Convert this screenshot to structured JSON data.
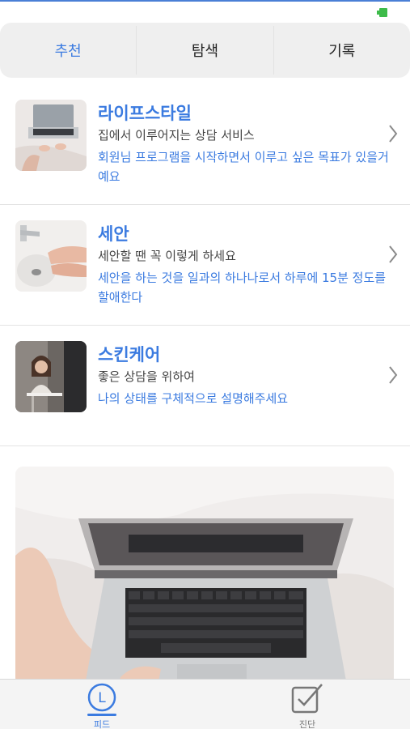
{
  "status": {
    "battery_color": "#3dbb4a"
  },
  "segment": {
    "tabs": [
      {
        "label": "추천",
        "active": true
      },
      {
        "label": "탐색",
        "active": false
      },
      {
        "label": "기록",
        "active": false
      }
    ]
  },
  "list": {
    "items": [
      {
        "title": "라이프스타일",
        "subtitle": "집에서 이루어지는 상담 서비스",
        "description": "회원님 프로그램을 시작하면서 이루고 싶은 목표가 있을거예요",
        "thumbnail": "laptop-on-bed"
      },
      {
        "title": "세안",
        "subtitle": "세안할 땐 꼭 이렇게 하세요",
        "description": "세안을 하는 것을 일과의 하나나로서 하루에 15분 정도를 할애한다",
        "thumbnail": "hands-washing-sink"
      },
      {
        "title": "스킨케어",
        "subtitle": "좋은 상담을 위하여",
        "description": "나의 상태를 구체적으로 설명해주세요",
        "thumbnail": "counseling-session"
      }
    ]
  },
  "photo": {
    "subject": "laptop-keyboard-on-bed"
  },
  "tabbar": {
    "feed_label": "피드",
    "feed_icon_letter": "L",
    "diag_label": "진단"
  },
  "colors": {
    "accent": "#3b7be0",
    "text": "#222222"
  }
}
